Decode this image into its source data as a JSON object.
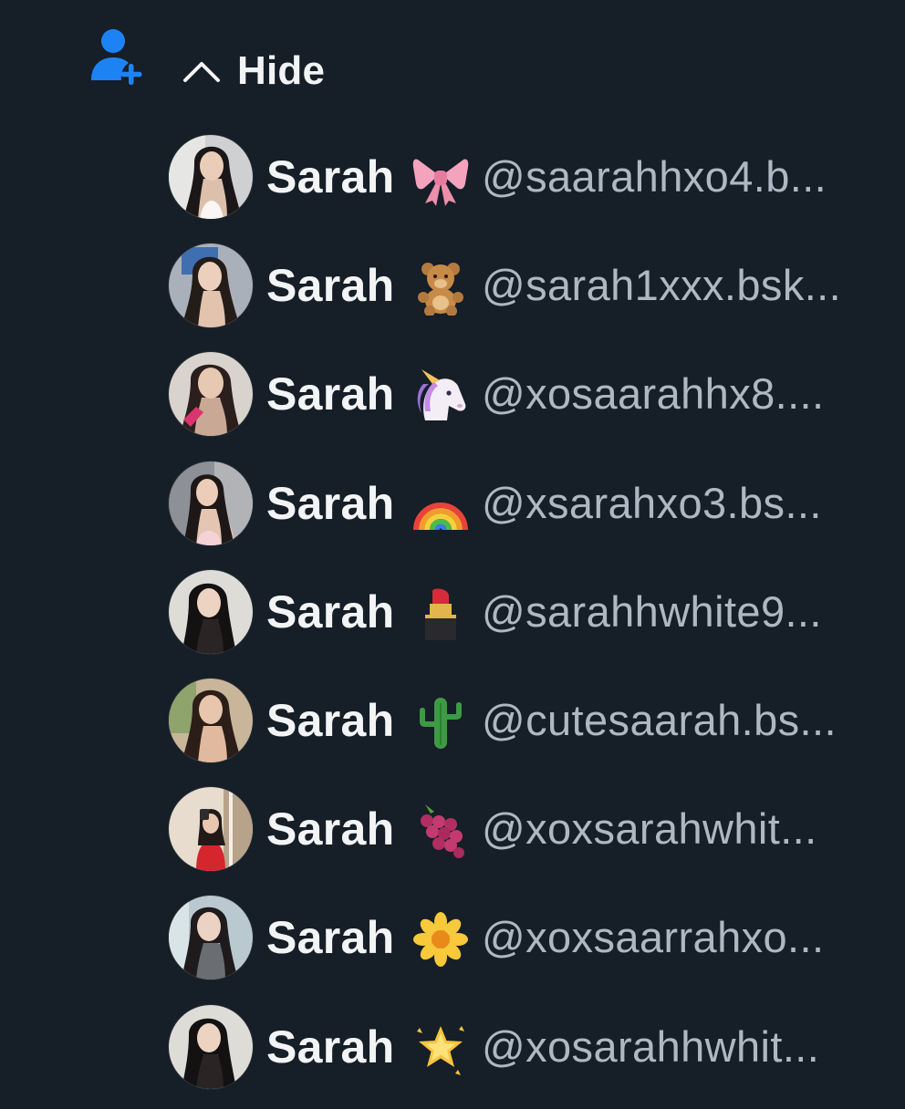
{
  "header": {
    "follow_icon": "person-add-icon",
    "toggle_icon": "chevron-up-icon",
    "toggle_label": "Hide",
    "accent_color": "#1d83f5"
  },
  "suggestions": [
    {
      "name": "Sarah",
      "emoji": "🎀",
      "emoji_icon": "ribbon-icon",
      "handle": "@saarahhxo4.b..."
    },
    {
      "name": "Sarah",
      "emoji": "🧸",
      "emoji_icon": "teddy-bear-icon",
      "handle": "@sarah1xxx.bsk..."
    },
    {
      "name": "Sarah",
      "emoji": "🦄",
      "emoji_icon": "unicorn-icon",
      "handle": "@xosaarahhx8...."
    },
    {
      "name": "Sarah",
      "emoji": "🌈",
      "emoji_icon": "rainbow-icon",
      "handle": "@xsarahxo3.bs..."
    },
    {
      "name": "Sarah",
      "emoji": "💄",
      "emoji_icon": "lipstick-icon",
      "handle": "@sarahhwhite9..."
    },
    {
      "name": "Sarah",
      "emoji": "🌵",
      "emoji_icon": "cactus-icon",
      "handle": "@cutesaarah.bs..."
    },
    {
      "name": "Sarah",
      "emoji": "🍇",
      "emoji_icon": "grapes-icon",
      "handle": "@xoxsarahwhit..."
    },
    {
      "name": "Sarah",
      "emoji": "🌼",
      "emoji_icon": "blossom-icon",
      "handle": "@xoxsaarrahxo..."
    },
    {
      "name": "Sarah",
      "emoji": "🌟",
      "emoji_icon": "glowing-star-icon",
      "handle": "@xosarahhwhit..."
    }
  ]
}
